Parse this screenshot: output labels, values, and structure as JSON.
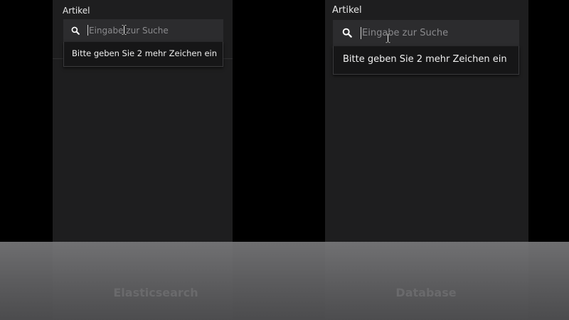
{
  "panels": {
    "left": {
      "section_label": "Artikel",
      "search_placeholder": "Eingabe zur Suche",
      "dropdown_message": "Bitte geben Sie 2 mehr Zeichen ein",
      "caption": "Elasticsearch"
    },
    "right": {
      "section_label": "Artikel",
      "search_placeholder": "Eingabe zur Suche",
      "dropdown_message": "Bitte geben Sie 2 mehr Zeichen ein",
      "caption": "Database"
    }
  },
  "icons": {
    "search": "search-icon",
    "text_cursor": "i-beam-cursor-icon"
  },
  "colors": {
    "background": "#000000",
    "panel": "#1e1e1f",
    "search_box": "#2c2c2e",
    "dropdown": "#161617",
    "text": "#f0f0f0",
    "placeholder": "#8a8a8d",
    "caption": "#6a6a6c"
  }
}
